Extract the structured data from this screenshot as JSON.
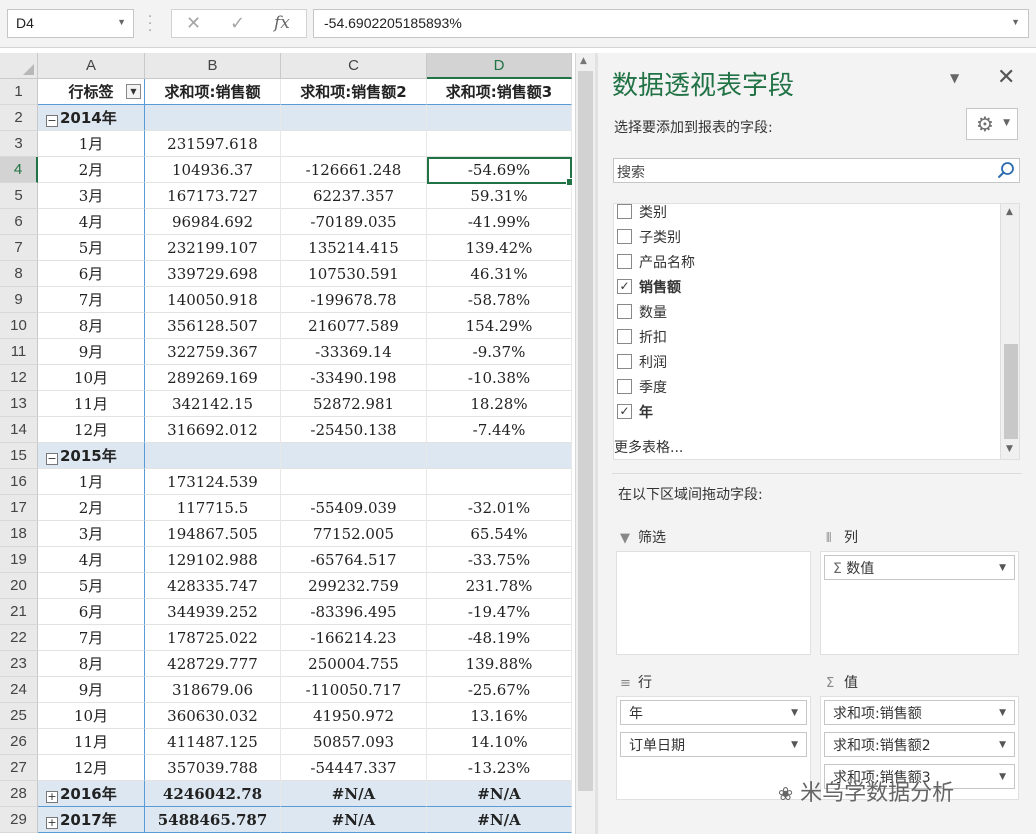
{
  "formula_bar": {
    "name_box": "D4",
    "formula": "-54.6902205185893%",
    "cancel_glyph": "✕",
    "enter_glyph": "✓",
    "fx_glyph": "fx"
  },
  "columns": [
    "A",
    "B",
    "C",
    "D"
  ],
  "header_row": {
    "row": "1",
    "a": "行标签",
    "b": "求和项:销售额",
    "c": "求和项:销售额2",
    "d": "求和项:销售额3"
  },
  "rows": [
    {
      "row": "2",
      "type": "year",
      "a": "2014年",
      "b": "",
      "c": "",
      "d": ""
    },
    {
      "row": "3",
      "type": "data",
      "a": "1月",
      "b": "231597.618",
      "c": "",
      "d": ""
    },
    {
      "row": "4",
      "type": "data",
      "a": "2月",
      "b": "104936.37",
      "c": "-126661.248",
      "d": "-54.69%"
    },
    {
      "row": "5",
      "type": "data",
      "a": "3月",
      "b": "167173.727",
      "c": "62237.357",
      "d": "59.31%"
    },
    {
      "row": "6",
      "type": "data",
      "a": "4月",
      "b": "96984.692",
      "c": "-70189.035",
      "d": "-41.99%"
    },
    {
      "row": "7",
      "type": "data",
      "a": "5月",
      "b": "232199.107",
      "c": "135214.415",
      "d": "139.42%"
    },
    {
      "row": "8",
      "type": "data",
      "a": "6月",
      "b": "339729.698",
      "c": "107530.591",
      "d": "46.31%"
    },
    {
      "row": "9",
      "type": "data",
      "a": "7月",
      "b": "140050.918",
      "c": "-199678.78",
      "d": "-58.78%"
    },
    {
      "row": "10",
      "type": "data",
      "a": "8月",
      "b": "356128.507",
      "c": "216077.589",
      "d": "154.29%"
    },
    {
      "row": "11",
      "type": "data",
      "a": "9月",
      "b": "322759.367",
      "c": "-33369.14",
      "d": "-9.37%"
    },
    {
      "row": "12",
      "type": "data",
      "a": "10月",
      "b": "289269.169",
      "c": "-33490.198",
      "d": "-10.38%"
    },
    {
      "row": "13",
      "type": "data",
      "a": "11月",
      "b": "342142.15",
      "c": "52872.981",
      "d": "18.28%"
    },
    {
      "row": "14",
      "type": "data",
      "a": "12月",
      "b": "316692.012",
      "c": "-25450.138",
      "d": "-7.44%"
    },
    {
      "row": "15",
      "type": "year",
      "a": "2015年",
      "b": "",
      "c": "",
      "d": ""
    },
    {
      "row": "16",
      "type": "data",
      "a": "1月",
      "b": "173124.539",
      "c": "",
      "d": ""
    },
    {
      "row": "17",
      "type": "data",
      "a": "2月",
      "b": "117715.5",
      "c": "-55409.039",
      "d": "-32.01%"
    },
    {
      "row": "18",
      "type": "data",
      "a": "3月",
      "b": "194867.505",
      "c": "77152.005",
      "d": "65.54%"
    },
    {
      "row": "19",
      "type": "data",
      "a": "4月",
      "b": "129102.988",
      "c": "-65764.517",
      "d": "-33.75%"
    },
    {
      "row": "20",
      "type": "data",
      "a": "5月",
      "b": "428335.747",
      "c": "299232.759",
      "d": "231.78%"
    },
    {
      "row": "21",
      "type": "data",
      "a": "6月",
      "b": "344939.252",
      "c": "-83396.495",
      "d": "-19.47%"
    },
    {
      "row": "22",
      "type": "data",
      "a": "7月",
      "b": "178725.022",
      "c": "-166214.23",
      "d": "-48.19%"
    },
    {
      "row": "23",
      "type": "data",
      "a": "8月",
      "b": "428729.777",
      "c": "250004.755",
      "d": "139.88%"
    },
    {
      "row": "24",
      "type": "data",
      "a": "9月",
      "b": "318679.06",
      "c": "-110050.717",
      "d": "-25.67%"
    },
    {
      "row": "25",
      "type": "data",
      "a": "10月",
      "b": "360630.032",
      "c": "41950.972",
      "d": "13.16%"
    },
    {
      "row": "26",
      "type": "data",
      "a": "11月",
      "b": "411487.125",
      "c": "50857.093",
      "d": "14.10%"
    },
    {
      "row": "27",
      "type": "data",
      "a": "12月",
      "b": "357039.788",
      "c": "-54447.337",
      "d": "-13.23%"
    },
    {
      "row": "28",
      "type": "total",
      "a": "2016年",
      "b": "4246042.78",
      "c": "#N/A",
      "d": "#N/A"
    },
    {
      "row": "29",
      "type": "total",
      "a": "2017年",
      "b": "5488465.787",
      "c": "#N/A",
      "d": "#N/A"
    }
  ],
  "pane": {
    "title": "数据透视表字段",
    "subtitle": "选择要添加到报表的字段:",
    "search_placeholder": "搜索",
    "fields": [
      {
        "label": "类别",
        "checked": false
      },
      {
        "label": "子类别",
        "checked": false
      },
      {
        "label": "产品名称",
        "checked": false
      },
      {
        "label": "销售额",
        "checked": true
      },
      {
        "label": "数量",
        "checked": false
      },
      {
        "label": "折扣",
        "checked": false
      },
      {
        "label": "利润",
        "checked": false
      },
      {
        "label": "季度",
        "checked": false
      },
      {
        "label": "年",
        "checked": true
      }
    ],
    "more_tables": "更多表格...",
    "drag_hint": "在以下区域间拖动字段:",
    "areas": {
      "filter": {
        "label": "筛选",
        "items": []
      },
      "columns": {
        "label": "列",
        "items": [
          "数值"
        ]
      },
      "rows": {
        "label": "行",
        "items": [
          "年",
          "订单日期"
        ]
      },
      "values": {
        "label": "值",
        "items": [
          "求和项:销售额",
          "求和项:销售额2",
          "求和项:销售额3"
        ]
      }
    }
  },
  "watermark": "米乌学数据分析"
}
